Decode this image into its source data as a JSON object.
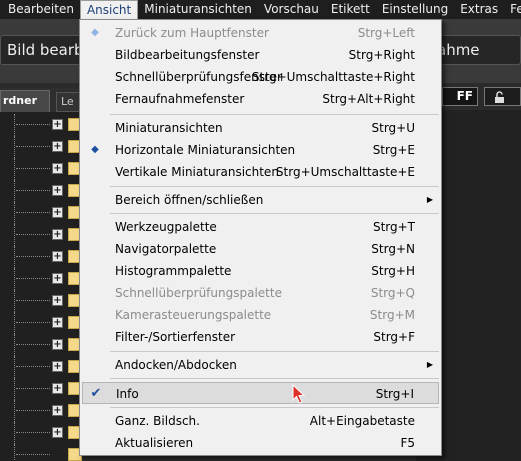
{
  "menubar": {
    "items": [
      {
        "label": "Bearbeiten"
      },
      {
        "label": "Ansicht"
      },
      {
        "label": "Miniaturansichten"
      },
      {
        "label": "Vorschau"
      },
      {
        "label": "Etikett"
      },
      {
        "label": "Einstellung"
      },
      {
        "label": "Extras"
      },
      {
        "label": "Fe"
      }
    ]
  },
  "toolbar": {
    "edit_button": "Bild bearbe",
    "right_field": "ahme"
  },
  "sidebar": {
    "tab_active": "rdner",
    "tab_inactive": "Le"
  },
  "controls": {
    "off_label": "FF",
    "lock_icon": "lock-icon"
  },
  "menu": {
    "items": [
      {
        "label": "Zurück zum Hauptfenster",
        "shortcut": "Strg+Left"
      },
      {
        "label": "Bildbearbeitungsfenster",
        "shortcut": "Strg+Right"
      },
      {
        "label": "Schnellüberprüfungsfenster",
        "shortcut": "Strg+Umschalttaste+Right"
      },
      {
        "label": "Fernaufnahmefenster",
        "shortcut": "Strg+Alt+Right"
      },
      {
        "label": "Miniaturansichten",
        "shortcut": "Strg+U"
      },
      {
        "label": "Horizontale Miniaturansichten",
        "shortcut": "Strg+E"
      },
      {
        "label": "Vertikale Miniaturansichten",
        "shortcut": "Strg+Umschalttaste+E"
      },
      {
        "label": "Bereich öffnen/schließen",
        "shortcut": ""
      },
      {
        "label": "Werkzeugpalette",
        "shortcut": "Strg+T"
      },
      {
        "label": "Navigatorpalette",
        "shortcut": "Strg+N"
      },
      {
        "label": "Histogrammpalette",
        "shortcut": "Strg+H"
      },
      {
        "label": "Schnellüberprüfungspalette",
        "shortcut": "Strg+Q"
      },
      {
        "label": "Kamerasteuerungspalette",
        "shortcut": "Strg+M"
      },
      {
        "label": "Filter-/Sortierfenster",
        "shortcut": "Strg+F"
      },
      {
        "label": "Andocken/Abdocken",
        "shortcut": ""
      },
      {
        "label": "Info",
        "shortcut": "Strg+I"
      },
      {
        "label": "Ganz. Bildsch.",
        "shortcut": "Alt+Eingabetaste"
      },
      {
        "label": "Aktualisieren",
        "shortcut": "F5"
      }
    ]
  },
  "colors": {
    "menubar_bg": "#1e1e1e",
    "menu_bg": "#f0f0f0",
    "highlight_bg": "#dcdcdc",
    "check_color": "#1c4f9c",
    "folder_color": "#f5d98a"
  }
}
